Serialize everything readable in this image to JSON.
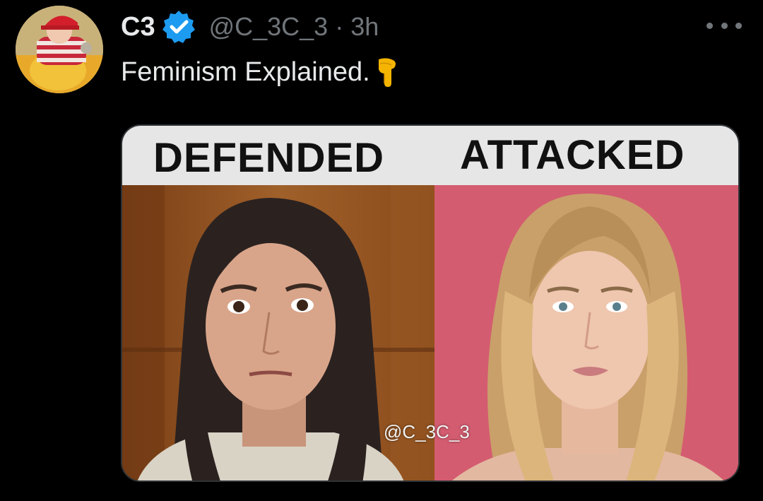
{
  "author": {
    "display_name": "C3",
    "handle": "@C_3C_3",
    "separator": "·",
    "timestamp": "3h",
    "verified": true
  },
  "tweet": {
    "text": "Feminism Explained.",
    "emoji": "backhand-index-pointing-down"
  },
  "media": {
    "left_label": "DEFENDED",
    "right_label": "ATTACKED",
    "watermark": "@C_3C_3"
  },
  "colors": {
    "background": "#000000",
    "primary_text": "#e7e9ea",
    "secondary_text": "#71767b",
    "verified_blue": "#1d9bf0",
    "banner": "#e6e6e6"
  }
}
